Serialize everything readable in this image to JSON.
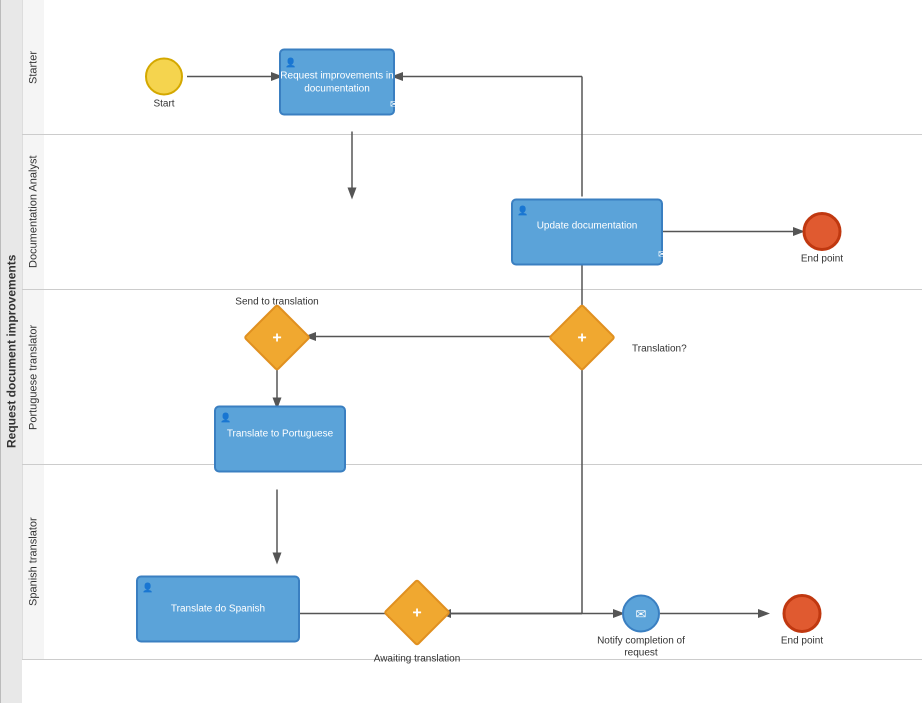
{
  "diagram": {
    "title": "Request document improvements",
    "pool_label": "Request document improvements",
    "lanes": [
      {
        "id": "starter",
        "label": "Starter"
      },
      {
        "id": "doc_analyst",
        "label": "Documentation Analyst"
      },
      {
        "id": "port_translator",
        "label": "Portuguese translator"
      },
      {
        "id": "spanish_translator",
        "label": "Spanish translator"
      }
    ],
    "elements": {
      "start": {
        "label": "Start"
      },
      "task_request": {
        "label": "Request improvements in\ndocumentation"
      },
      "task_update": {
        "label": "Update documentation"
      },
      "gateway_translation": {
        "label": "Translation?"
      },
      "gateway_send": {
        "label": "Send to translation"
      },
      "task_portuguese": {
        "label": "Translate to Portuguese"
      },
      "task_spanish": {
        "label": "Translate do Spanish"
      },
      "gateway_awaiting": {
        "label": "Awaiting translation"
      },
      "message_notify": {
        "label": "Notify completion of\nrequest"
      },
      "end_doc": {
        "label": "End point"
      },
      "end_spanish": {
        "label": "End point"
      }
    }
  }
}
